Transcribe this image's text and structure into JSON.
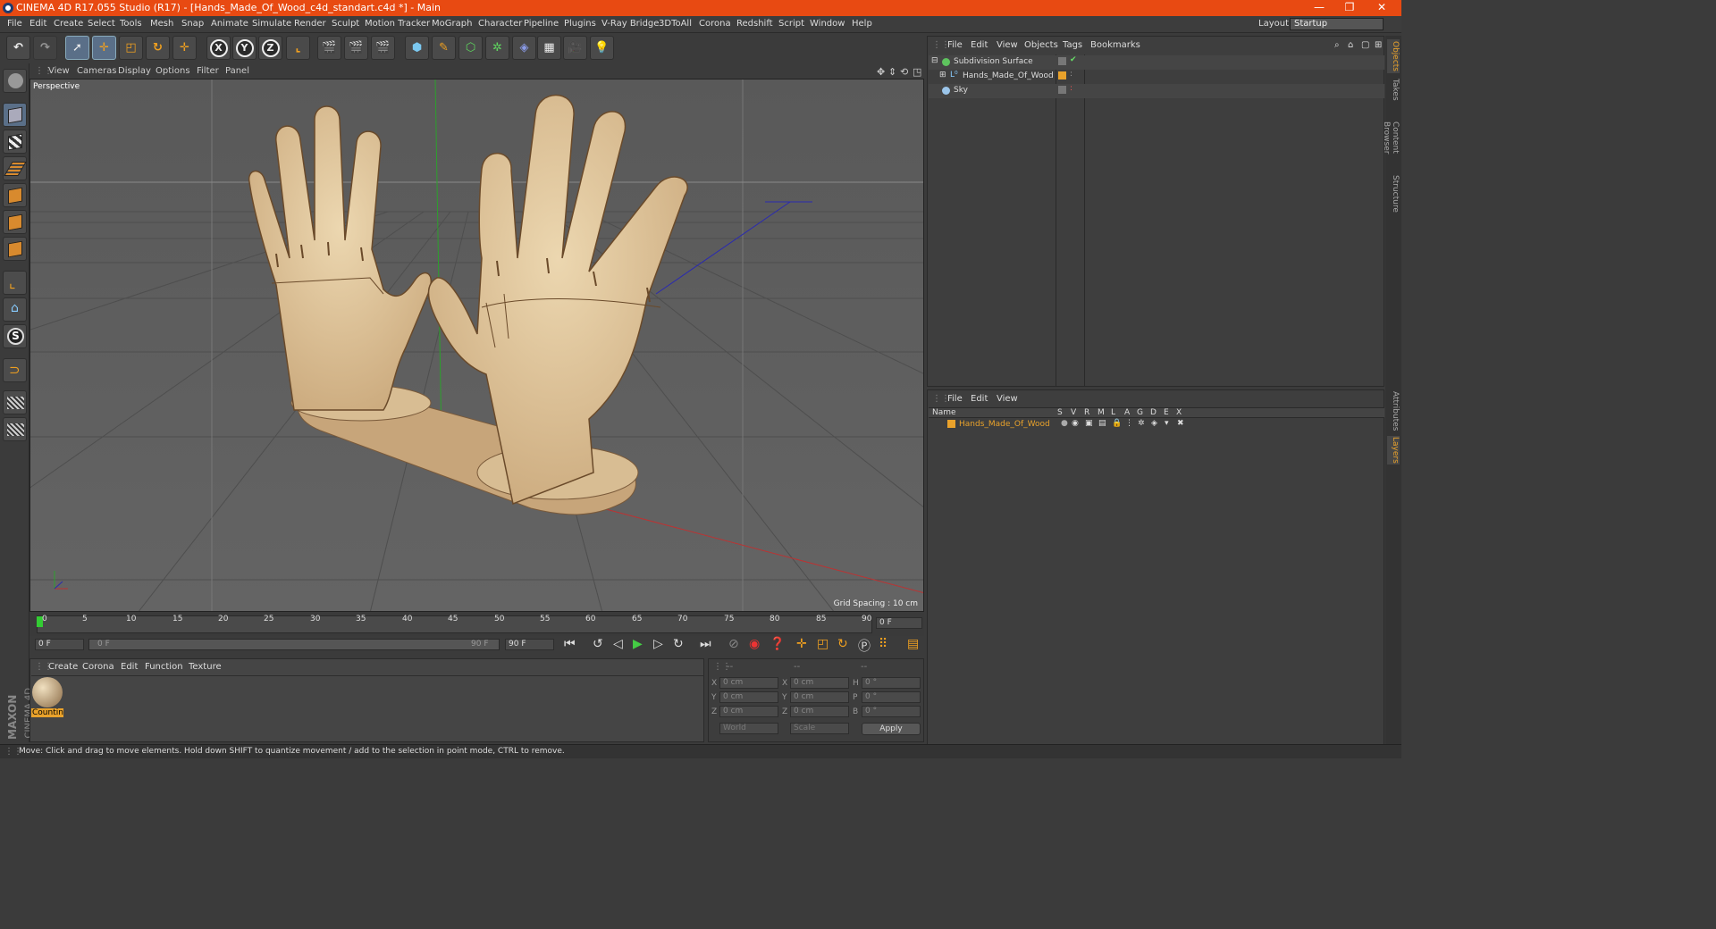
{
  "window": {
    "title": "CINEMA 4D R17.055 Studio (R17) - [Hands_Made_Of_Wood_c4d_standart.c4d *] - Main",
    "controls": [
      "—",
      "❐",
      "✕"
    ]
  },
  "menu": {
    "items": [
      "File",
      "Edit",
      "Create",
      "Select",
      "Tools",
      "Mesh",
      "Snap",
      "Animate",
      "Simulate",
      "Render",
      "Sculpt",
      "Motion Tracker",
      "MoGraph",
      "Character",
      "Pipeline",
      "Plugins",
      "V-Ray Bridge",
      "3DToAll",
      "Corona",
      "Redshift",
      "Script",
      "Window",
      "Help"
    ],
    "layout_label": "Layout:",
    "layout_value": "Startup"
  },
  "toolbar": {
    "x_label": "X",
    "y_label": "Y",
    "z_label": "Z"
  },
  "viewport": {
    "menu": [
      "View",
      "Cameras",
      "Display",
      "Options",
      "Filter",
      "Panel"
    ],
    "name": "Perspective",
    "grid_spacing": "Grid Spacing : 10 cm"
  },
  "timeline": {
    "ticks": [
      "0",
      "5",
      "10",
      "15",
      "20",
      "25",
      "30",
      "35",
      "40",
      "45",
      "50",
      "55",
      "60",
      "65",
      "70",
      "75",
      "80",
      "85",
      "90"
    ],
    "current_frame": "0 F",
    "start_frame": "0 F",
    "range_start": "0 F",
    "range_end": "90 F",
    "end_frame": "90 F"
  },
  "materials": {
    "menu": [
      "Create",
      "Corona",
      "Edit",
      "Function",
      "Texture"
    ],
    "item_name": "Countin",
    "brand_top": "MAXON",
    "brand_bottom": "CINEMA 4D"
  },
  "coords": {
    "headers": [
      "--",
      "--",
      "--"
    ],
    "rows": [
      {
        "a": "X",
        "v1": "0 cm",
        "b": "X",
        "v2": "0 cm",
        "c": "H",
        "v3": "0 °"
      },
      {
        "a": "Y",
        "v1": "0 cm",
        "b": "Y",
        "v2": "0 cm",
        "c": "P",
        "v3": "0 °"
      },
      {
        "a": "Z",
        "v1": "0 cm",
        "b": "Z",
        "v2": "0 cm",
        "c": "B",
        "v3": "0 °"
      }
    ],
    "mode1": "World",
    "mode2": "Scale",
    "apply": "Apply"
  },
  "object_manager": {
    "menu": [
      "File",
      "Edit",
      "View",
      "Objects",
      "Tags",
      "Bookmarks"
    ],
    "objects": [
      {
        "name": "Subdivision Surface",
        "indent": 0
      },
      {
        "name": "Hands_Made_Of_Wood",
        "indent": 1
      },
      {
        "name": "Sky",
        "indent": 0
      }
    ]
  },
  "layer_manager": {
    "menu": [
      "File",
      "Edit",
      "View"
    ],
    "columns": [
      "Name",
      "S",
      "V",
      "R",
      "M",
      "L",
      "A",
      "G",
      "D",
      "E",
      "X"
    ],
    "layer_name": "Hands_Made_Of_Wood"
  },
  "side_tabs": [
    "Objects",
    "Takes",
    "Content Browser",
    "Structure",
    "Attributes",
    "Layers"
  ],
  "status": "Move: Click and drag to move elements. Hold down SHIFT to quantize movement / add to the selection in point mode, CTRL to remove.",
  "colors": {
    "titlebar": "#e84a12",
    "accent": "#e9a22b",
    "wood": "#e2c9a0"
  }
}
